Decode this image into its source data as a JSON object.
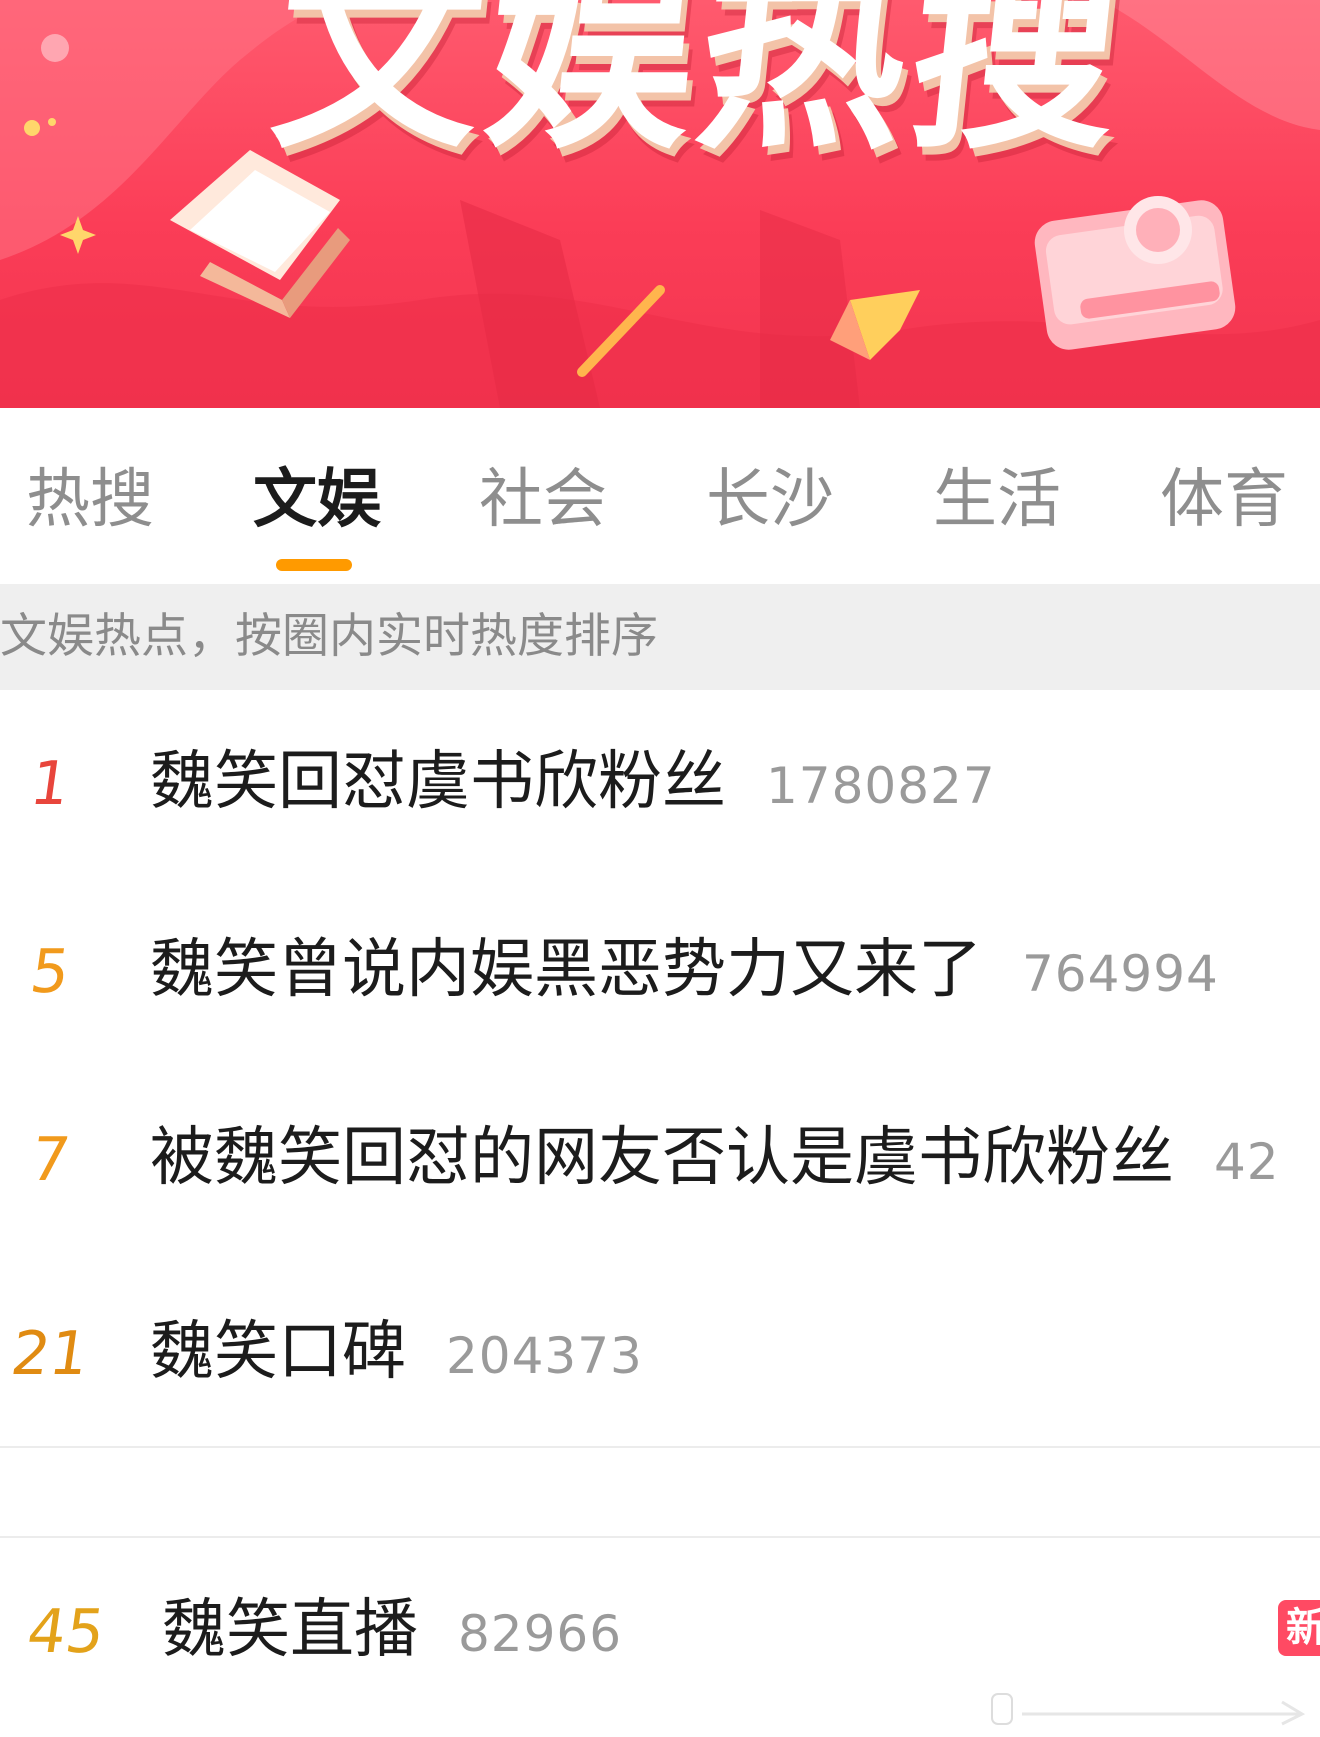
{
  "banner": {
    "title": "文娱热搜"
  },
  "tabs": [
    {
      "label": "热搜",
      "active": false
    },
    {
      "label": "文娱",
      "active": true
    },
    {
      "label": "社会",
      "active": false
    },
    {
      "label": "长沙",
      "active": false
    },
    {
      "label": "生活",
      "active": false
    },
    {
      "label": "体育",
      "active": false
    }
  ],
  "subtitle": "文娱热点，按圈内实时热度排序",
  "list": [
    {
      "rank": "1",
      "topic": "魏笑回怼虞书欣粉丝",
      "heat": "1780827",
      "rank_color": "#e8453c"
    },
    {
      "rank": "5",
      "topic": "魏笑曾说内娱黑恶势力又来了",
      "heat": "764994",
      "rank_color": "#f19a1c"
    },
    {
      "rank": "7",
      "topic": "被魏笑回怼的网友否认是虞书欣粉丝",
      "heat": "42",
      "rank_color": "#f19a1c"
    },
    {
      "rank": "21",
      "topic": "魏笑口碑",
      "heat": "204373",
      "rank_color": "#e08b12"
    },
    {
      "rank": "45",
      "topic": "魏笑直播",
      "heat": "82966",
      "rank_color": "#e3a21a",
      "badge": "新"
    }
  ],
  "colors": {
    "accent": "#ff9a00",
    "banner_red": "#fb3d57",
    "new_badge": "#ff4a63"
  }
}
